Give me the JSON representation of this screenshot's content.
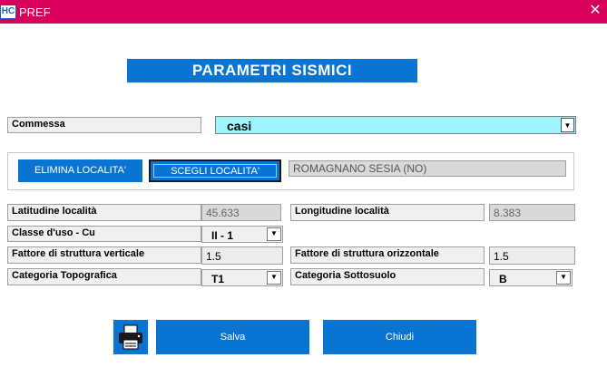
{
  "window": {
    "title": "PREF",
    "app_icon_text": "HC",
    "close_glyph": "✕"
  },
  "header": {
    "title": "PARAMETRI SISMICI"
  },
  "commessa": {
    "label": "Commessa",
    "value": "casi"
  },
  "localita": {
    "delete_label": "ELIMINA LOCALITA'",
    "choose_label": "SCEGLI LOCALITA'",
    "name": "ROMAGNANO SESIA (NO)"
  },
  "latitude": {
    "label": "Latitudine località",
    "value": "45.633"
  },
  "longitude": {
    "label": "Longitudine località",
    "value": "8.383"
  },
  "classe_uso": {
    "label": "Classe d'uso  - Cu",
    "value": "II - 1"
  },
  "fattore_verticale": {
    "label": "Fattore di struttura verticale",
    "value": "1.5"
  },
  "fattore_orizzontale": {
    "label": "Fattore di struttura orizzontale",
    "value": "1.5"
  },
  "categoria_topografica": {
    "label": "Categoria Topografica",
    "value": "T1"
  },
  "categoria_sottosuolo": {
    "label": "Categoria Sottosuolo",
    "value": "B"
  },
  "actions": {
    "print_icon": "printer-icon",
    "save_label": "Salva",
    "close_label": "Chiudi"
  },
  "colors": {
    "titlebar": "#d9005b",
    "accent": "#0a74d2",
    "commessa_field": "#9ff5ff"
  }
}
